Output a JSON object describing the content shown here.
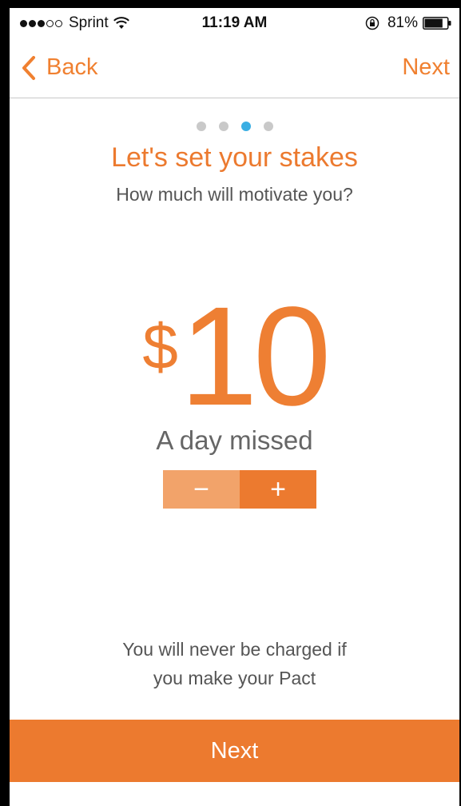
{
  "status_bar": {
    "carrier": "Sprint",
    "signal": {
      "filled": 3,
      "total": 5
    },
    "time": "11:19 AM",
    "battery": "81%",
    "battery_level": 0.81
  },
  "nav": {
    "back_label": "Back",
    "next_label": "Next"
  },
  "pager": {
    "total": 4,
    "active_index": 2
  },
  "title": "Let's set your stakes",
  "subtitle": "How much will motivate you?",
  "amount": {
    "currency": "$",
    "value": "10",
    "caption": "A day missed"
  },
  "stepper": {
    "minus_label": "−",
    "plus_label": "+"
  },
  "note": {
    "line1": "You will never be charged if",
    "line2": "you make your Pact"
  },
  "footer": {
    "next_label": "Next"
  },
  "colors": {
    "accent": "#ec7a2f",
    "accent_light": "#f2a36a",
    "active_dot": "#3aaee3"
  }
}
